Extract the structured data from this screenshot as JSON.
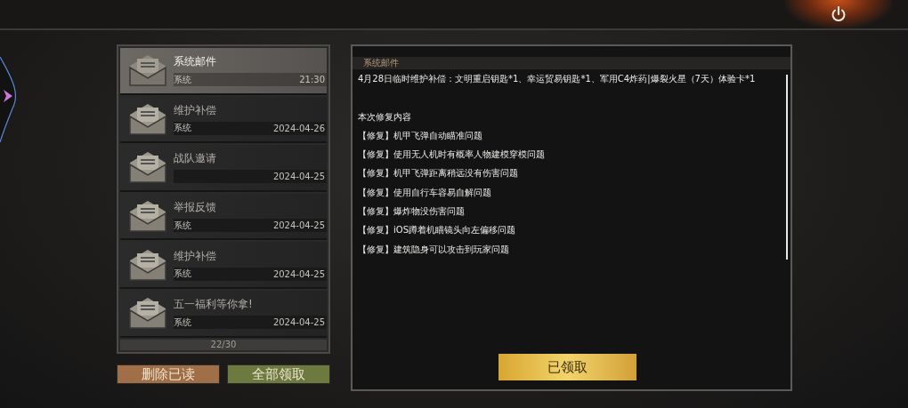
{
  "mail_list": {
    "items": [
      {
        "title": "系统邮件",
        "sender": "系统",
        "time": "21:30",
        "selected": true
      },
      {
        "title": "维护补偿",
        "sender": "系统",
        "time": "2024-04-26",
        "selected": false
      },
      {
        "title": "战队邀请",
        "time": "2024-04-25",
        "selected": false
      },
      {
        "title": "举报反馈",
        "sender": "系统",
        "time": "2024-04-25",
        "selected": false
      },
      {
        "title": "维护补偿",
        "sender": "系统",
        "time": "2024-04-25",
        "selected": false
      },
      {
        "title": "五一福利等你拿!",
        "sender": "系统",
        "time": "2024-04-25",
        "selected": false
      }
    ],
    "count": "22/30"
  },
  "actions": [
    "删除已读",
    "全部领取"
  ],
  "message": {
    "header": "系统邮件",
    "lines": [
      "4月28日临时维护补偿：文明重启钥匙*1、幸运贸易钥匙*1、军用C4炸药|爆裂火星（7天）体验卡*1"
    ],
    "section_title": "本次修复内容",
    "fixes": [
      "【修复】机甲飞弹自动瞄准问题",
      "【修复】使用无人机时有概率人物建模穿模问题",
      "【修复】机甲飞弹距离稍远没有伤害问题",
      "【修复】使用自行车容易自解问题",
      "【修复】爆炸物没伤害问题",
      "【修复】iOS蹲着机瞄镜头向左偏移问题",
      "【修复】建筑隐身可以攻击到玩家问题"
    ],
    "claim_button": "已领取"
  }
}
